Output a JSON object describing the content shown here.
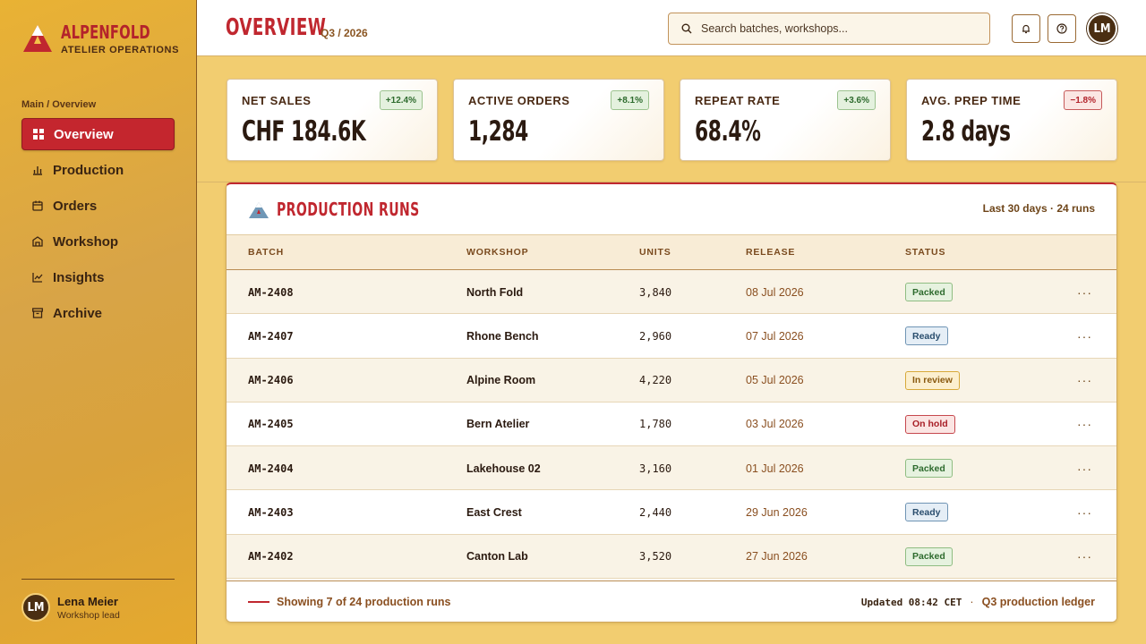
{
  "brand": {
    "name": "ALPENFOLD",
    "subtitle": "ATELIER OPERATIONS"
  },
  "sidebar": {
    "caption": "Main / Overview",
    "items": [
      {
        "label": "Overview",
        "icon": "grid-icon",
        "active": true
      },
      {
        "label": "Production",
        "icon": "bar-chart-icon"
      },
      {
        "label": "Orders",
        "icon": "calendar-icon"
      },
      {
        "label": "Workshop",
        "icon": "building-icon"
      },
      {
        "label": "Insights",
        "icon": "line-chart-icon"
      },
      {
        "label": "Archive",
        "icon": "archive-icon"
      }
    ],
    "user": {
      "initials": "LM",
      "name": "Lena Meier",
      "role": "Workshop lead"
    }
  },
  "header": {
    "title": "OVERVIEW",
    "period": "Q3 / 2026",
    "search_placeholder": "Search batches, workshops...",
    "avatar_initials": "LM"
  },
  "kpis": [
    {
      "label": "NET SALES",
      "value": "CHF 184.6K",
      "delta": "+12.4%",
      "trend": "up"
    },
    {
      "label": "ACTIVE ORDERS",
      "value": "1,284",
      "delta": "+8.1%",
      "trend": "up"
    },
    {
      "label": "REPEAT RATE",
      "value": "68.4%",
      "delta": "+3.6%",
      "trend": "up"
    },
    {
      "label": "AVG. PREP TIME",
      "value": "2.8 days",
      "delta": "−1.8%",
      "trend": "down"
    }
  ],
  "table": {
    "title": "PRODUCTION RUNS",
    "meta": "Last 30 days · 24 runs",
    "columns": [
      "BATCH",
      "WORKSHOP",
      "UNITS",
      "RELEASE",
      "STATUS"
    ],
    "rows": [
      {
        "batch": "AM-2408",
        "workshop": "North Fold",
        "units": "3,840",
        "release": "08 Jul 2026",
        "status": "Packed"
      },
      {
        "batch": "AM-2407",
        "workshop": "Rhone Bench",
        "units": "2,960",
        "release": "07 Jul 2026",
        "status": "Ready"
      },
      {
        "batch": "AM-2406",
        "workshop": "Alpine Room",
        "units": "4,220",
        "release": "05 Jul 2026",
        "status": "In review"
      },
      {
        "batch": "AM-2405",
        "workshop": "Bern Atelier",
        "units": "1,780",
        "release": "03 Jul 2026",
        "status": "On hold"
      },
      {
        "batch": "AM-2404",
        "workshop": "Lakehouse 02",
        "units": "3,160",
        "release": "01 Jul 2026",
        "status": "Packed"
      },
      {
        "batch": "AM-2403",
        "workshop": "East Crest",
        "units": "2,440",
        "release": "29 Jun 2026",
        "status": "Ready"
      },
      {
        "batch": "AM-2402",
        "workshop": "Canton Lab",
        "units": "3,520",
        "release": "27 Jun 2026",
        "status": "Packed"
      }
    ],
    "row_action": "···",
    "footer": {
      "showing": "Showing 7 of 24 production runs",
      "updated": "Updated 08:42 CET",
      "separator": "·",
      "ledger": "Q3 production ledger"
    }
  },
  "colors": {
    "accent": "#c0272f",
    "sidebar": "#e0a73a",
    "background": "#f2cd70"
  }
}
